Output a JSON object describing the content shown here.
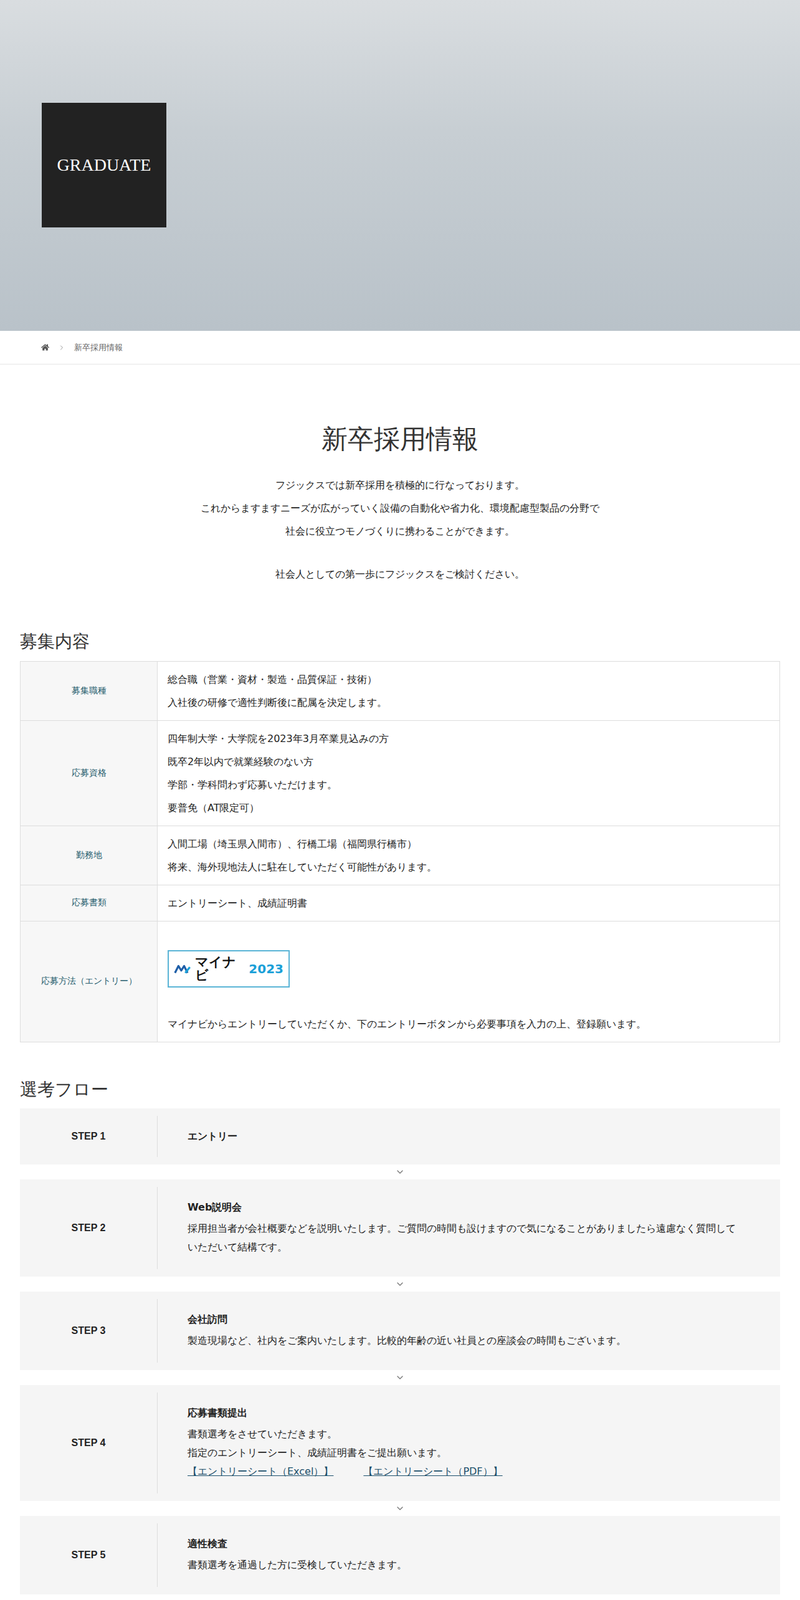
{
  "hero": {
    "badge": "GRADUATE"
  },
  "breadcrumb": {
    "items": [
      "新卒採用情報"
    ]
  },
  "page": {
    "title": "新卒採用情報",
    "intro": [
      "フジックスでは新卒採用を積極的に行なっております。",
      "これからますますニーズが広がっていく設備の自動化や省力化、環境配慮型製品の分野で",
      "社会に役立つモノづくりに携わることができます。"
    ],
    "closing": "社会人としての第一歩にフジックスをご検討ください。"
  },
  "recruitment": {
    "heading": "募集内容",
    "rows": [
      {
        "kind": "text",
        "label": "募集職種",
        "lines": [
          "総合職（営業・資材・製造・品質保証・技術）",
          "入社後の研修で適性判断後に配属を決定します。"
        ]
      },
      {
        "kind": "text",
        "label": "応募資格",
        "lines": [
          "四年制大学・大学院を2023年3月卒業見込みの方",
          "既卒2年以内で就業経験のない方",
          "学部・学科問わず応募いただけます。",
          "要普免（AT限定可）"
        ]
      },
      {
        "kind": "text",
        "label": "勤務地",
        "lines": [
          "入間工場（埼玉県入間市）、行橋工場（福岡県行橋市）",
          "将来、海外現地法人に駐在していただく可能性があります。"
        ]
      },
      {
        "kind": "text",
        "label": "応募書類",
        "lines": [
          "エントリーシート、成績証明書"
        ]
      },
      {
        "kind": "entry",
        "label": "応募方法（エントリー）",
        "logo": {
          "brand": "マイナビ",
          "year": "2023"
        },
        "lines": [
          "マイナビからエントリーしていただくか、下のエントリーボタンから必要事項を入力の上、登録願います。"
        ]
      }
    ]
  },
  "flow": {
    "heading": "選考フロー",
    "steps": [
      {
        "step": "STEP 1",
        "title": "エントリー",
        "lines": [],
        "links": []
      },
      {
        "step": "STEP 2",
        "title": "Web説明会",
        "lines": [
          "採用担当者が会社概要などを説明いたします。ご質問の時間も設けますので気になることがありましたら遠慮なく質問していただいて結構です。"
        ],
        "links": []
      },
      {
        "step": "STEP 3",
        "title": "会社訪問",
        "lines": [
          "製造現場など、社内をご案内いたします。比較的年齢の近い社員との座談会の時間もございます。"
        ],
        "links": []
      },
      {
        "step": "STEP 4",
        "title": "応募書類提出",
        "lines": [
          "書類選考をさせていただきます。",
          "指定のエントリーシート、成績証明書をご提出願います。"
        ],
        "links": [
          "【エントリーシート（Excel）】",
          "【エントリーシート（PDF）】"
        ]
      },
      {
        "step": "STEP 5",
        "title": "適性検査",
        "lines": [
          "書類選考を通過した方に受検していただきます。"
        ],
        "links": []
      }
    ]
  }
}
